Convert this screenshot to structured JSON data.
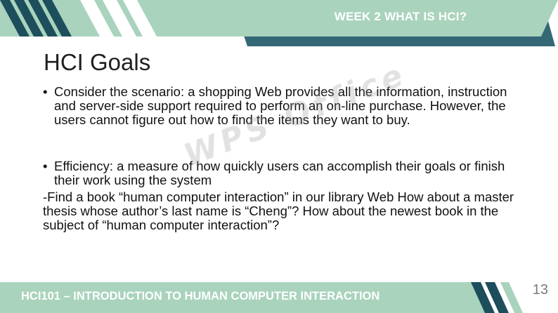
{
  "header": {
    "title": "WEEK 2 WHAT IS HCI?"
  },
  "slide": {
    "title": "HCI Goals",
    "bullets": [
      "Consider the scenario: a shopping Web provides all the information, instruction and server-side support required to perform an on-line purchase. However, the users cannot figure out how to find the items they want to buy.",
      "Efficiency: a measure of how quickly users can accomplish their goals or finish their work using the system"
    ],
    "paragraph": "-Find a book “human computer interaction” in our library Web How about a master thesis whose author’s last name is “Cheng”? How about the newest book in the subject of “human computer interaction”?"
  },
  "watermark": "WPS Office",
  "footer": {
    "title": "HCI101 – INTRODUCTION TO HUMAN COMPUTER INTERACTION",
    "page_number": "13"
  },
  "colors": {
    "header_band": "#a9d3bd",
    "dark_stripe": "#1c4e5c",
    "white_stripe": "#ffffff",
    "footer_band": "#a9d3bd",
    "text": "#111111",
    "page_number": "#7a7a7a"
  },
  "icons": [
    "header-stripes",
    "footer-stripes"
  ]
}
